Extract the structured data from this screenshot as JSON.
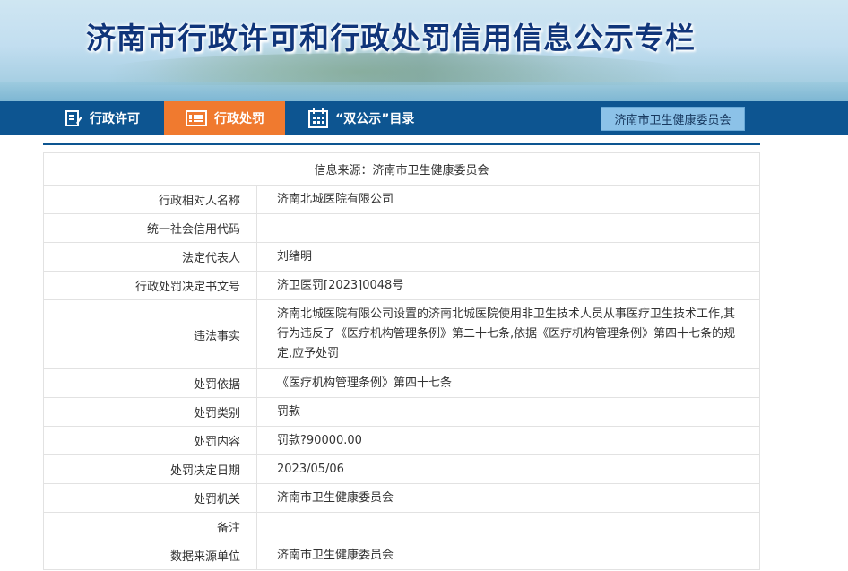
{
  "header": {
    "title": "济南市行政许可和行政处罚信用信息公示专栏"
  },
  "nav": {
    "items": [
      {
        "label": "行政许可",
        "icon": "document-edit-icon",
        "active": false
      },
      {
        "label": "行政处罚",
        "icon": "list-icon",
        "active": true
      },
      {
        "label": "“双公示”目录",
        "icon": "calendar-icon",
        "active": false
      }
    ],
    "right_button": "济南市卫生健康委员会"
  },
  "colors": {
    "nav_bg": "#0d5591",
    "active_tab": "#f07a2f",
    "right_button_bg": "#8cc2e8",
    "title_text": "#10357a"
  },
  "detail": {
    "source_line": "信息来源：济南市卫生健康委员会",
    "rows": [
      {
        "label": "行政相对人名称",
        "value": "济南北城医院有限公司"
      },
      {
        "label": "统一社会信用代码",
        "value": ""
      },
      {
        "label": "法定代表人",
        "value": "刘绪明"
      },
      {
        "label": "行政处罚决定书文号",
        "value": "济卫医罚[2023]0048号"
      },
      {
        "label": "违法事实",
        "value": "济南北城医院有限公司设置的济南北城医院使用非卫生技术人员从事医疗卫生技术工作,其行为违反了《医疗机构管理条例》第二十七条,依据《医疗机构管理条例》第四十七条的规定,应予处罚"
      },
      {
        "label": "处罚依据",
        "value": "《医疗机构管理条例》第四十七条"
      },
      {
        "label": "处罚类别",
        "value": "罚款"
      },
      {
        "label": "处罚内容",
        "value": "罚款?90000.00"
      },
      {
        "label": "处罚决定日期",
        "value": "2023/05/06"
      },
      {
        "label": "处罚机关",
        "value": "济南市卫生健康委员会"
      },
      {
        "label": "备注",
        "value": ""
      },
      {
        "label": "数据来源单位",
        "value": "济南市卫生健康委员会"
      }
    ]
  }
}
